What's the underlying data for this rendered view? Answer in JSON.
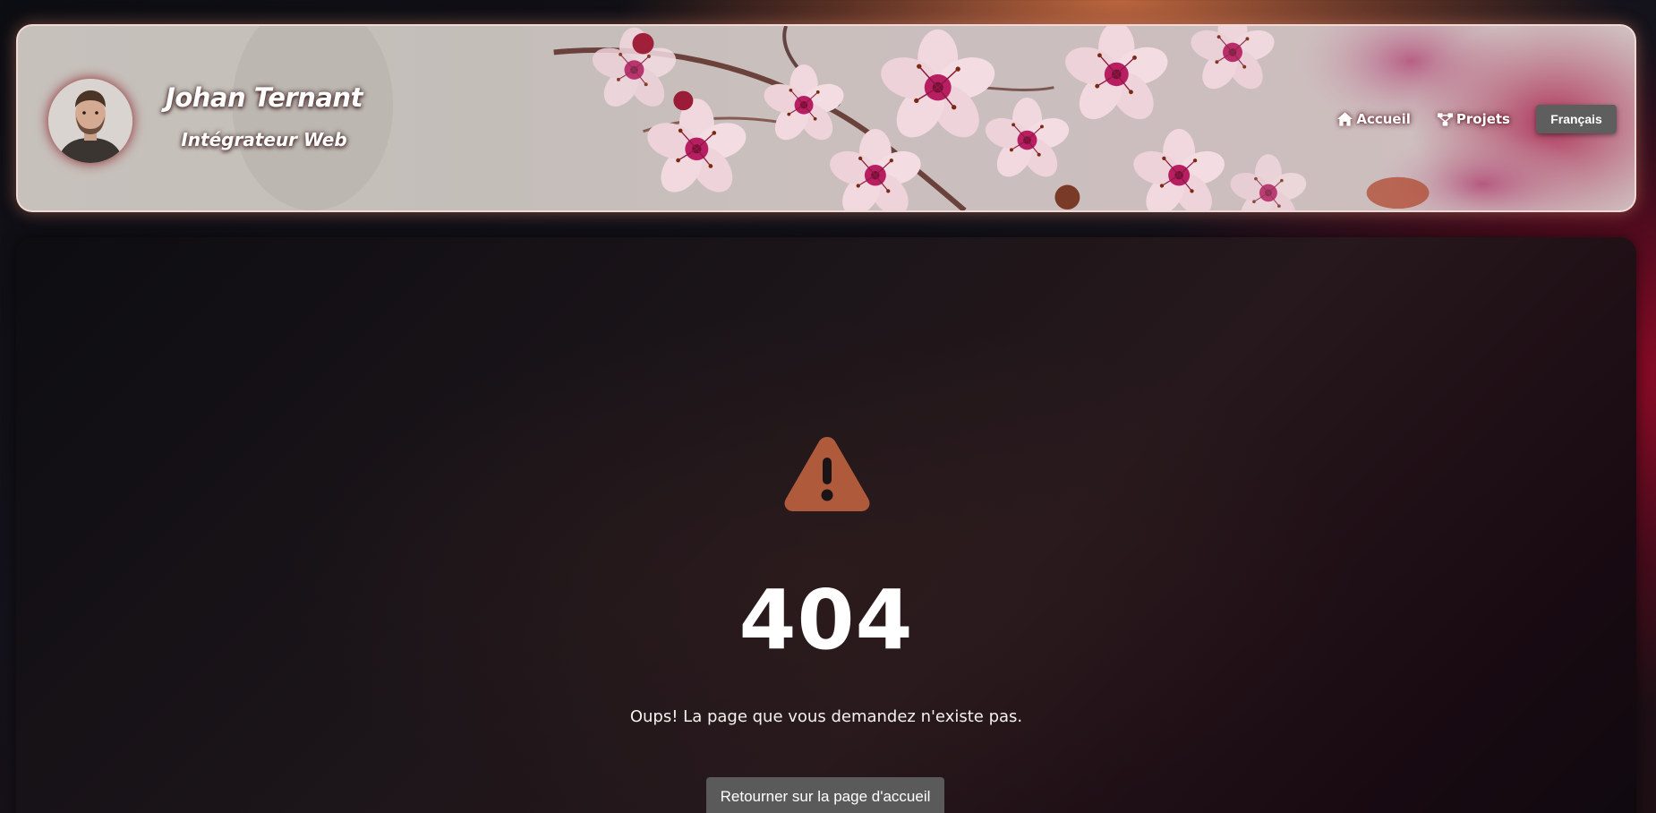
{
  "header": {
    "name": "Johan Ternant",
    "role": "Intégrateur Web",
    "avatar_alt": "avatar",
    "nav": [
      {
        "label": "Accueil",
        "icon": "home-icon"
      },
      {
        "label": "Projets",
        "icon": "project-tree-icon"
      }
    ],
    "language": {
      "selected": "Français"
    }
  },
  "error_page": {
    "icon": "warning-triangle-icon",
    "code": "404",
    "message": "Oups! La page que vous demandez n'existe pas.",
    "button_label": "Retourner sur la page d'accueil"
  },
  "colors": {
    "warning_icon": "#b05a3c",
    "button_bg": "#5a5a5a",
    "header_border": "#f5dcd7",
    "accent_red": "#960a28",
    "accent_orange": "#c46a40"
  }
}
